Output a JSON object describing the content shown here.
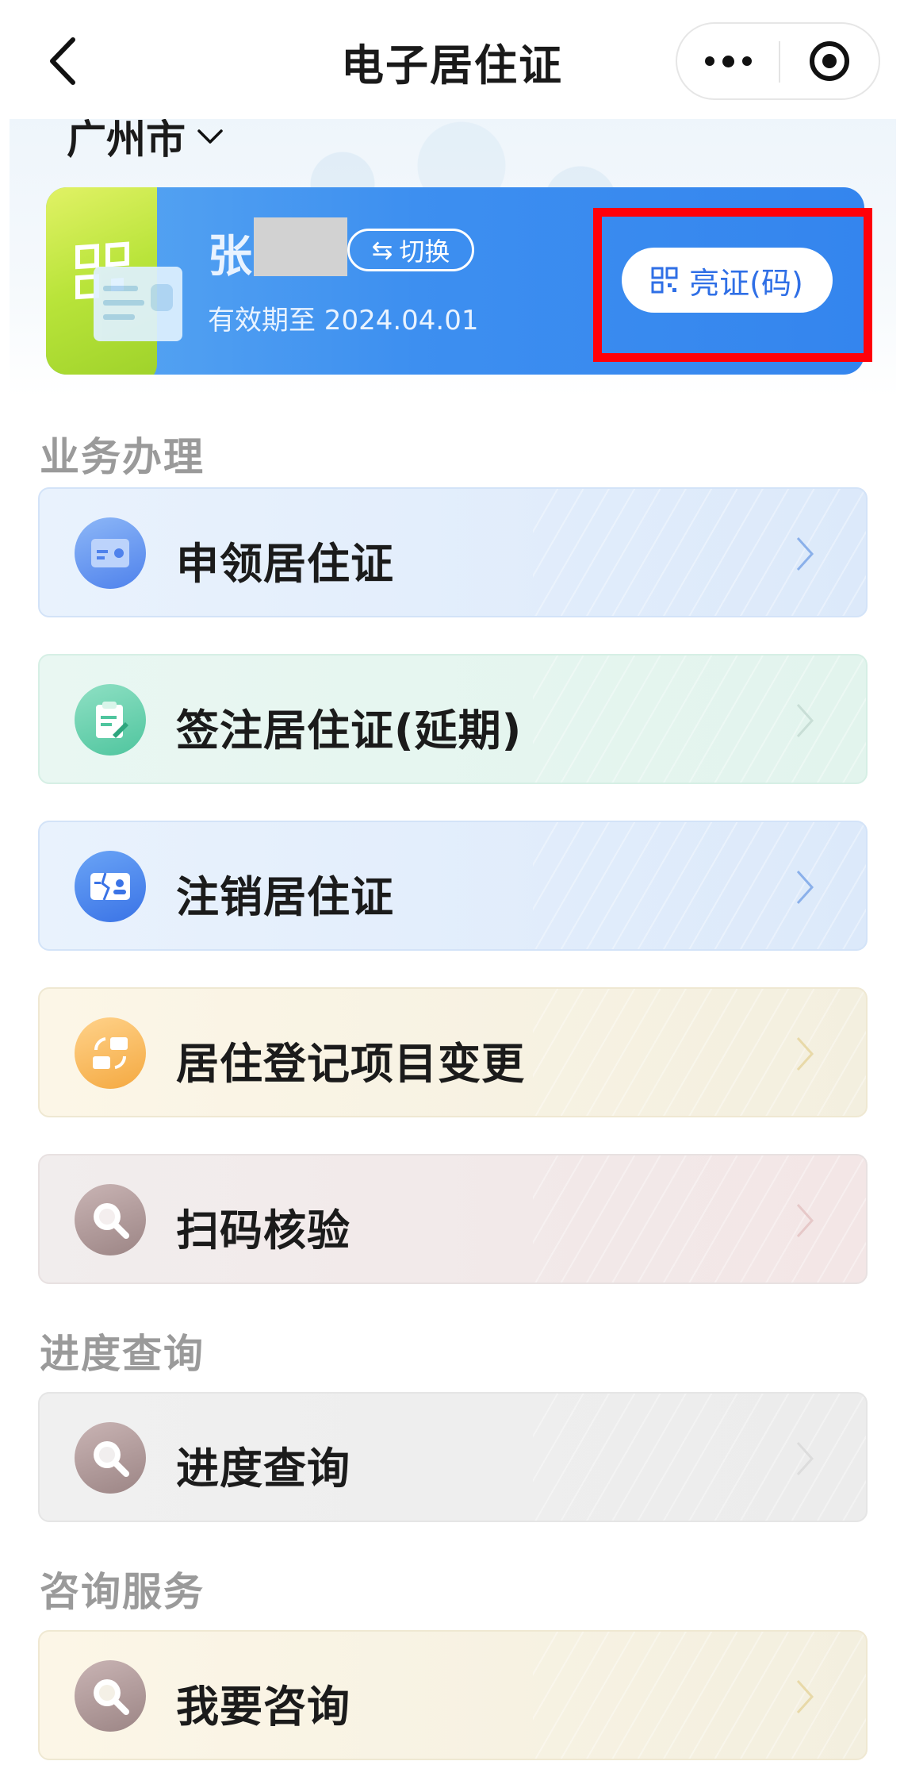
{
  "navbar": {
    "title": "电子居住证",
    "back_icon": "chevron-left-icon",
    "more_icon": "more-dots-icon",
    "close_icon": "target-circle-icon"
  },
  "header": {
    "city": "广州市",
    "city_icon": "chevron-down-icon"
  },
  "id_card": {
    "name": "张",
    "switch_label": "切换",
    "validity": "有效期至 2024.04.01",
    "show_button_label": "亮证(码)",
    "show_button_icon": "qr-code-icon",
    "highlight_color": "#ff0008"
  },
  "sections": {
    "business": {
      "title": "业务办理",
      "items": [
        {
          "label": "申领居住证",
          "icon": "id-card-icon",
          "color": "#4f82ec"
        },
        {
          "label": "签注居住证(延期)",
          "icon": "clipboard-edit-icon",
          "color": "#4fc59e"
        },
        {
          "label": "注销居住证",
          "icon": "id-card-cancel-icon",
          "color": "#3a73e6"
        },
        {
          "label": "居住登记项目变更",
          "icon": "swap-cards-icon",
          "color": "#f4a941"
        },
        {
          "label": "扫码核验",
          "icon": "magnifier-icon",
          "color": "#9c8585"
        }
      ]
    },
    "progress": {
      "title": "进度查询",
      "items": [
        {
          "label": "进度查询",
          "icon": "magnifier-icon",
          "color": "#9c8585"
        }
      ]
    },
    "consult": {
      "title": "咨询服务",
      "items": [
        {
          "label": "我要咨询",
          "icon": "magnifier-icon",
          "color": "#9c8585"
        }
      ]
    }
  }
}
